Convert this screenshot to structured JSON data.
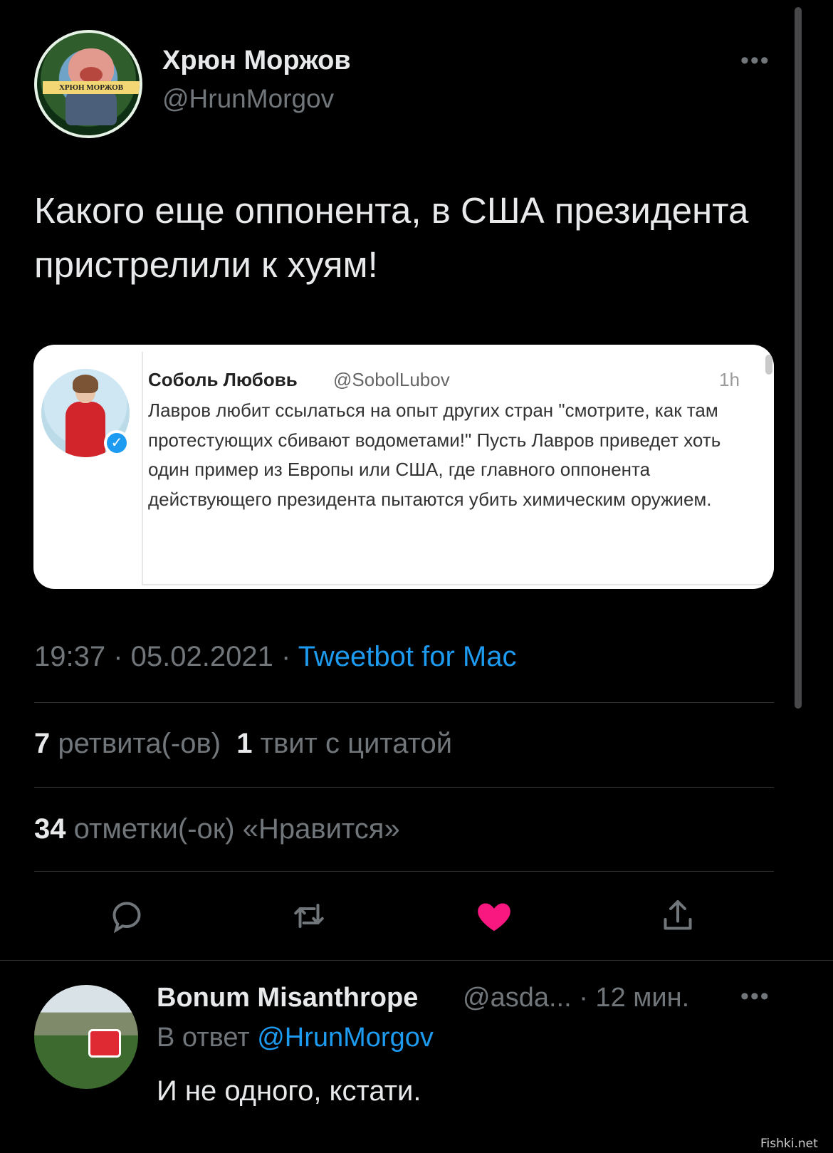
{
  "tweet": {
    "author_name": "Хрюн Моржов",
    "author_handle": "@HrunMorgov",
    "avatar_banner": "ХРЮН МОРЖОВ",
    "more_icon": "•••",
    "text": "Какого еще оппонента, в США президента пристрелили к хуям!"
  },
  "quoted": {
    "author_name": "Соболь Любовь",
    "author_handle": "@SobolLubov",
    "time": "1h",
    "verified_icon": "✓",
    "text": "Лавров любит ссылаться на опыт других стран \"смотрите, как там протестующих сбивают водометами!\" Пусть Лавров приведет хоть один пример из Европы или США, где главного оппонента действующего президента пытаются убить химическим оружием."
  },
  "meta": {
    "time": "19:37",
    "separator": " · ",
    "date": "05.02.2021",
    "source": "Tweetbot for Mac"
  },
  "stats": {
    "retweets_count": "7",
    "retweets_label": "ретвита(-ов)",
    "quotes_count": "1",
    "quotes_label": "твит с цитатой",
    "likes_count": "34",
    "likes_label": "отметки(-ок) «Нравится»"
  },
  "actions": {
    "icons": [
      "reply-icon",
      "retweet-icon",
      "like-icon",
      "share-icon"
    ],
    "like_color": "#f91880"
  },
  "reply": {
    "author_name": "Bonum Misanthrope",
    "author_handle": "@asda...",
    "time": "· 12 мин.",
    "more_icon": "•••",
    "reply_to_prefix": "В ответ ",
    "reply_to_handle": "@HrunMorgov",
    "text": "И не одного, кстати."
  },
  "watermark": "Fishki.net",
  "colors": {
    "background": "#000000",
    "accent": "#1d9bf0",
    "secondary_text": "#71767b"
  }
}
